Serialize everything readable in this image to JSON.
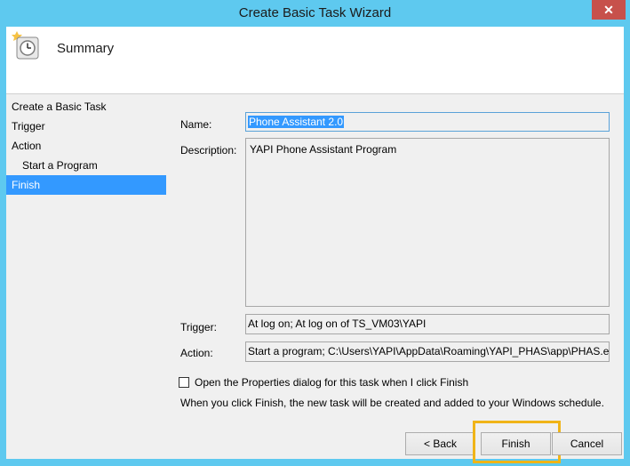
{
  "window": {
    "title": "Create Basic Task Wizard",
    "close_glyph": "✕"
  },
  "header": {
    "title": "Summary",
    "icon": "clock-task-icon"
  },
  "nav": {
    "items": [
      {
        "label": "Create a Basic Task",
        "sub": false,
        "selected": false
      },
      {
        "label": "Trigger",
        "sub": false,
        "selected": false
      },
      {
        "label": "Action",
        "sub": false,
        "selected": false
      },
      {
        "label": "Start a Program",
        "sub": true,
        "selected": false
      },
      {
        "label": "Finish",
        "sub": false,
        "selected": true
      }
    ]
  },
  "form": {
    "name_label": "Name:",
    "name_value": "Phone Assistant 2.0",
    "description_label": "Description:",
    "description_value": "YAPI Phone Assistant Program",
    "trigger_label": "Trigger:",
    "trigger_value": "At log on; At log on of TS_VM03\\YAPI",
    "action_label": "Action:",
    "action_value": "Start a program; C:\\Users\\YAPI\\AppData\\Roaming\\YAPI_PHAS\\app\\PHAS.exe",
    "checkbox_label": "Open the Properties dialog for this task when I click Finish",
    "checkbox_checked": false,
    "info_text": "When you click Finish, the new task will be created and added to your Windows schedule."
  },
  "buttons": {
    "back": "< Back",
    "finish": "Finish",
    "cancel": "Cancel"
  },
  "colors": {
    "titlebar": "#5ec9ef",
    "selection": "#3399ff",
    "highlight": "#f0b418",
    "close": "#c7514b"
  }
}
